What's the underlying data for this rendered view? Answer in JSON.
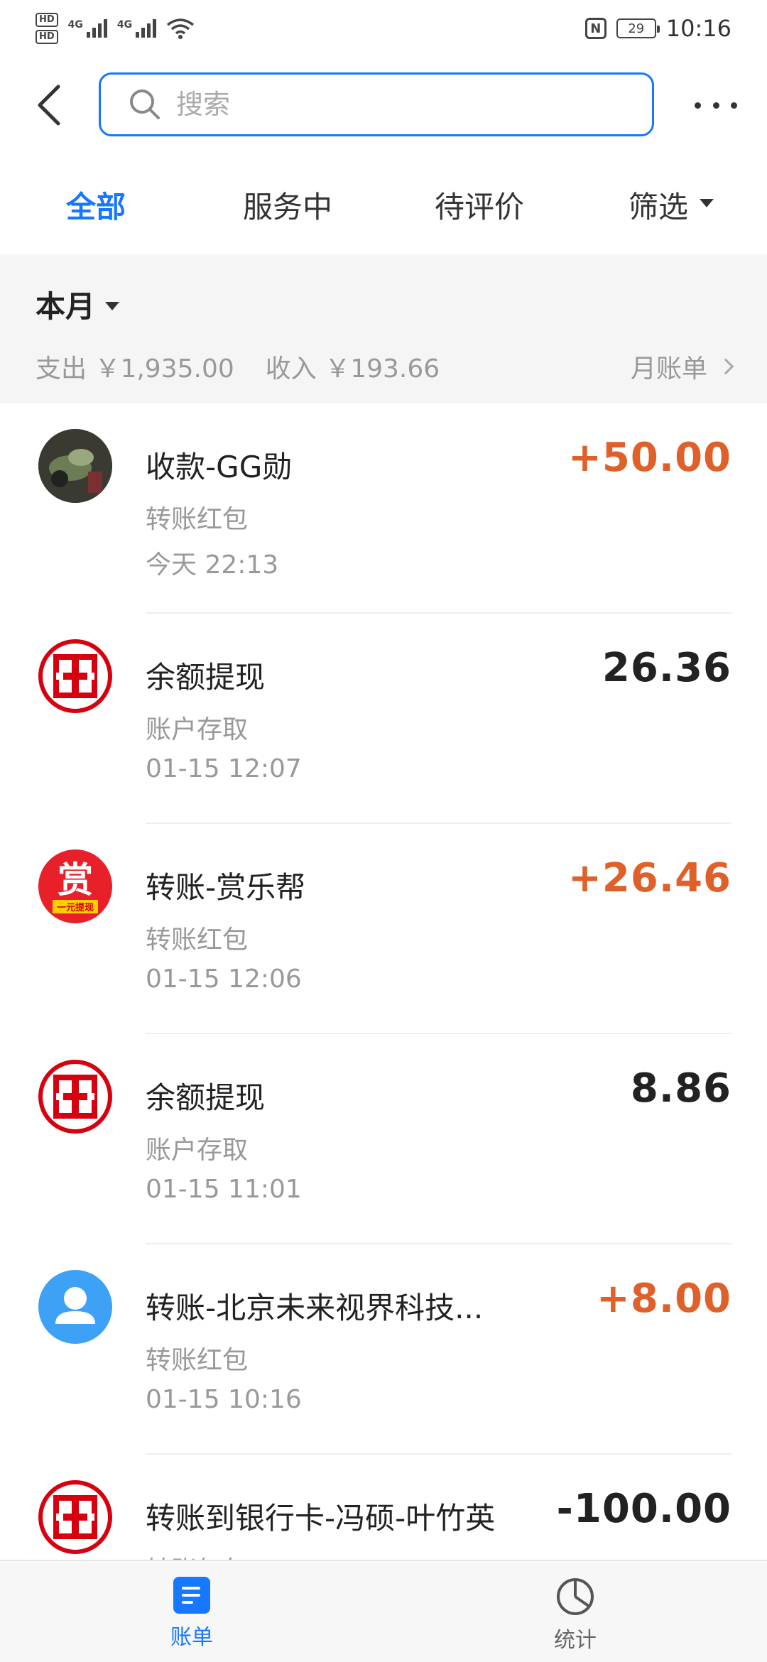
{
  "status_bar": {
    "hd1": "HD",
    "hd2": "HD",
    "net1": "4G",
    "net2": "4G",
    "nfc": "N",
    "battery": "29",
    "time": "10:16"
  },
  "header": {
    "search_placeholder": "搜索"
  },
  "tabs": [
    {
      "label": "全部"
    },
    {
      "label": "服务中"
    },
    {
      "label": "待评价"
    },
    {
      "label": "筛选"
    }
  ],
  "month": {
    "title": "本月",
    "expense": "支出 ￥1,935.00",
    "income": "收入 ￥193.66",
    "monthly_bill": "月账单"
  },
  "transactions": [
    {
      "title": "收款-GG勋",
      "subtitle": "转账红包",
      "time": "今天  22:13",
      "amount": "+50.00",
      "type": "income",
      "avatar": "photo-avatar"
    },
    {
      "title": "余额提现",
      "subtitle": "账户存取",
      "time": "01-15  12:07",
      "amount": "26.36",
      "type": "neutral",
      "avatar": "icbc-logo"
    },
    {
      "title": "转账-赏乐帮",
      "subtitle": "转账红包",
      "time": "01-15  12:06",
      "amount": "+26.46",
      "type": "income",
      "avatar": "reward-logo",
      "avatar_text": "赏",
      "avatar_sub": "一元提现"
    },
    {
      "title": "余额提现",
      "subtitle": "账户存取",
      "time": "01-15  11:01",
      "amount": "8.86",
      "type": "neutral",
      "avatar": "icbc-logo"
    },
    {
      "title": "转账-北京未来视界科技...",
      "subtitle": "转账红包",
      "time": "01-15  10:16",
      "amount": "+8.00",
      "type": "income",
      "avatar": "default-user-avatar"
    },
    {
      "title": "转账到银行卡-冯硕-叶竹英",
      "subtitle": "转账红包",
      "time": "",
      "amount": "-100.00",
      "type": "neutral",
      "avatar": "icbc-logo"
    }
  ],
  "bottom_nav": [
    {
      "label": "账单",
      "icon": "bill-icon",
      "active": true
    },
    {
      "label": "统计",
      "icon": "pie-chart-icon",
      "active": false
    }
  ],
  "colors": {
    "accent": "#1677ff",
    "income": "#e0602a",
    "icbc_red": "#d7000f"
  }
}
